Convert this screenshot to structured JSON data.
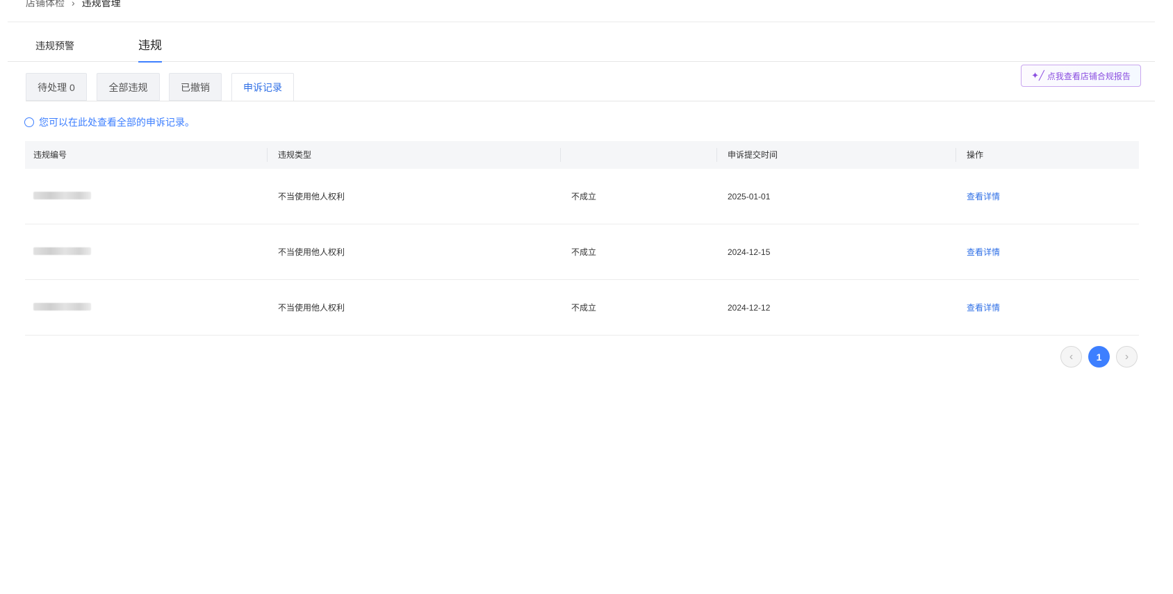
{
  "breadcrumb": {
    "items": [
      "店铺体检",
      "违规管理"
    ],
    "separator": "›"
  },
  "main_tabs": [
    {
      "label": "违规预警",
      "active": false
    },
    {
      "label": "违规",
      "active": true
    }
  ],
  "sub_tabs": [
    {
      "label": "待处理 0",
      "active": false
    },
    {
      "label": "全部违规",
      "active": false
    },
    {
      "label": "已撤销",
      "active": false
    },
    {
      "label": "申诉记录",
      "active": true
    }
  ],
  "report_button": {
    "label": "点我查看店铺合规报告",
    "icon": "magic-wand-icon"
  },
  "notice": {
    "text": "您可以在此处查看全部的申诉记录。",
    "icon": "info-circle-icon"
  },
  "table": {
    "columns": [
      "违规编号",
      "违规类型",
      "",
      "申诉提交时间",
      "操作"
    ],
    "rows": [
      {
        "id": "",
        "type": "不当使用他人权利",
        "result": "不成立",
        "submit_time": "2025-01-01",
        "action": "查看详情"
      },
      {
        "id": "",
        "type": "不当使用他人权利",
        "result": "不成立",
        "submit_time": "2024-12-15",
        "action": "查看详情"
      },
      {
        "id": "",
        "type": "不当使用他人权利",
        "result": "不成立",
        "submit_time": "2024-12-12",
        "action": "查看详情"
      }
    ]
  },
  "pagination": {
    "prev": "‹",
    "current": "1",
    "next": "›"
  },
  "colors": {
    "accent": "#3d7fff",
    "link": "#2f6fe6",
    "report_border": "#c9a6ef"
  }
}
